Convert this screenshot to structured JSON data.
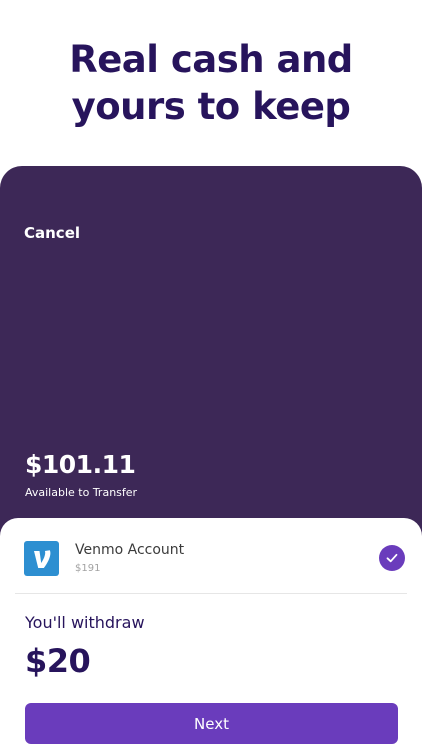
{
  "headline": {
    "line1": "Real cash and",
    "line2": "yours to keep"
  },
  "header": {
    "cancel_label": "Cancel"
  },
  "balance": {
    "amount": "$101.11",
    "label": "Available to Transfer"
  },
  "account": {
    "name": "Venmo Account",
    "balance": "$191",
    "logo_icon": "venmo-logo-icon",
    "selected": true
  },
  "withdraw": {
    "label": "You'll withdraw",
    "amount": "$20"
  },
  "actions": {
    "next_label": "Next"
  },
  "colors": {
    "headline": "#27145c",
    "panel": "#3d2857",
    "accent": "#6a3cbc",
    "venmo_blue": "#2d8fd1"
  }
}
